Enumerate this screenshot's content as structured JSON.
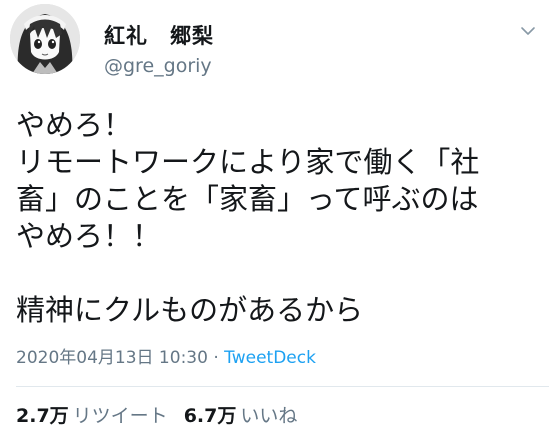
{
  "user": {
    "display_name": "紅礼　郷梨",
    "handle": "@gre_goriy"
  },
  "tweet": {
    "lines": [
      "やめろ！",
      "リモートワークにより家で働く「社",
      "畜」のことを「家畜」って呼ぶのは",
      "やめろ！！",
      "",
      "精神にクルものがあるから"
    ],
    "timestamp": "2020年04月13日 10:30",
    "separator": " · ",
    "source": "TweetDeck"
  },
  "stats": {
    "retweets_count": "2.7万",
    "retweets_label": "リツイート",
    "likes_count": "6.7万",
    "likes_label": "いいね"
  },
  "icons": {
    "avatar": "anime-character-avatar",
    "menu": "chevron-down-icon"
  },
  "colors": {
    "text": "#14171a",
    "secondary": "#657786",
    "link": "#1da1f2"
  }
}
